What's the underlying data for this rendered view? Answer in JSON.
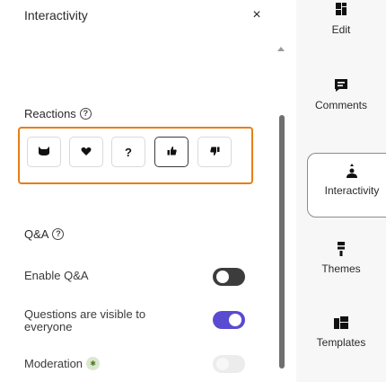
{
  "panel": {
    "title": "Interactivity",
    "close_glyph": "×",
    "reactions": {
      "label": "Reactions",
      "help_glyph": "?",
      "items": [
        {
          "name": "cat-reaction",
          "glyph": "😺",
          "active": false
        },
        {
          "name": "heart-reaction",
          "glyph": "♥",
          "active": false
        },
        {
          "name": "question-reaction",
          "glyph": "?",
          "active": false
        },
        {
          "name": "thumbs-up-reaction",
          "glyph": "👍",
          "active": true
        },
        {
          "name": "thumbs-down-reaction",
          "glyph": "👎",
          "active": false
        }
      ]
    },
    "qa": {
      "label": "Q&A",
      "help_glyph": "?",
      "enable_label": "Enable Q&A",
      "enable_state": "off",
      "visible_label_line1": "Questions are visible to",
      "visible_label_line2": "everyone",
      "visible_state": "on",
      "moderation_label": "Moderation",
      "moderation_badge": "✱",
      "moderation_state": "disabled"
    }
  },
  "sidebar": {
    "items": [
      {
        "label": "Edit",
        "icon": "edit-icon"
      },
      {
        "label": "Comments",
        "icon": "comments-icon"
      },
      {
        "label": "Interactivity",
        "icon": "interactivity-icon",
        "active": true
      },
      {
        "label": "Themes",
        "icon": "themes-icon"
      },
      {
        "label": "Templates",
        "icon": "templates-icon"
      }
    ]
  },
  "colors": {
    "highlight": "#e67e17",
    "toggle_on": "#5a4bd1",
    "toggle_off": "#3c3c3c"
  }
}
